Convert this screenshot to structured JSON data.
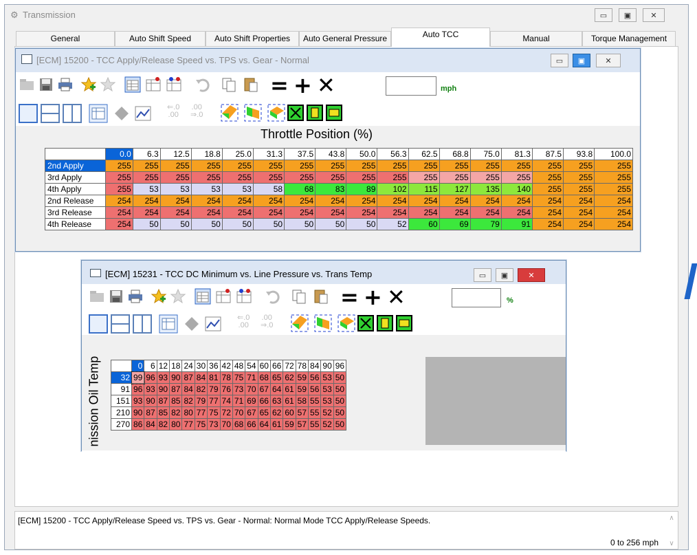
{
  "main_window": {
    "title": "Transmission",
    "tabs": [
      {
        "label": "General"
      },
      {
        "label": "Auto Shift Speed"
      },
      {
        "label": "Auto Shift Properties"
      },
      {
        "label": "Auto General Pressure"
      },
      {
        "label": "Auto TCC"
      },
      {
        "label": "Manual"
      },
      {
        "label": "Torque Management"
      }
    ],
    "active_tab": "Auto TCC",
    "status_description": "[ECM] 15200 - TCC Apply/Release Speed vs. TPS vs. Gear - Normal: Normal Mode TCC Apply/Release Speeds.",
    "status_range": "0 to 256 mph"
  },
  "window1": {
    "title": "[ECM] 15200 - TCC Apply/Release Speed vs. TPS vs. Gear - Normal",
    "unit": "mph",
    "axis_title": "Throttle Position (%)",
    "column_headers": [
      "0.0",
      "6.3",
      "12.5",
      "18.8",
      "25.0",
      "31.3",
      "37.5",
      "43.8",
      "50.0",
      "56.3",
      "62.5",
      "68.8",
      "75.0",
      "81.3",
      "87.5",
      "93.8",
      "100.0"
    ],
    "rows": [
      {
        "label": "2nd Apply",
        "values": [
          "255",
          "255",
          "255",
          "255",
          "255",
          "255",
          "255",
          "255",
          "255",
          "255",
          "255",
          "255",
          "255",
          "255",
          "255",
          "255",
          "255"
        ],
        "colors": [
          "o",
          "o",
          "o",
          "o",
          "o",
          "o",
          "o",
          "o",
          "o",
          "o",
          "o",
          "o",
          "o",
          "o",
          "o",
          "o",
          "o"
        ]
      },
      {
        "label": "3rd Apply",
        "values": [
          "255",
          "255",
          "255",
          "255",
          "255",
          "255",
          "255",
          "255",
          "255",
          "255",
          "255",
          "255",
          "255",
          "255",
          "255",
          "255",
          "255"
        ],
        "colors": [
          "r",
          "r",
          "r",
          "r",
          "r",
          "r",
          "r",
          "r",
          "r",
          "r",
          "p",
          "p",
          "p",
          "p",
          "o",
          "o",
          "o"
        ]
      },
      {
        "label": "4th Apply",
        "values": [
          "255",
          "53",
          "53",
          "53",
          "53",
          "58",
          "68",
          "83",
          "89",
          "102",
          "115",
          "127",
          "135",
          "140",
          "255",
          "255",
          "255"
        ],
        "colors": [
          "r",
          "l",
          "l",
          "l",
          "l",
          "l",
          "g",
          "g",
          "g",
          "g2",
          "g2",
          "g2",
          "g2",
          "g2",
          "o",
          "o",
          "o"
        ]
      },
      {
        "label": "2nd Release",
        "values": [
          "254",
          "254",
          "254",
          "254",
          "254",
          "254",
          "254",
          "254",
          "254",
          "254",
          "254",
          "254",
          "254",
          "254",
          "254",
          "254",
          "254"
        ],
        "colors": [
          "o",
          "o",
          "o",
          "o",
          "o",
          "o",
          "o",
          "o",
          "o",
          "o",
          "o",
          "o",
          "o",
          "o",
          "o",
          "o",
          "o"
        ]
      },
      {
        "label": "3rd Release",
        "values": [
          "254",
          "254",
          "254",
          "254",
          "254",
          "254",
          "254",
          "254",
          "254",
          "254",
          "254",
          "254",
          "254",
          "254",
          "254",
          "254",
          "254"
        ],
        "colors": [
          "r",
          "r",
          "r",
          "r",
          "r",
          "r",
          "r",
          "r",
          "r",
          "r",
          "r",
          "r",
          "r",
          "r",
          "o",
          "o",
          "o"
        ]
      },
      {
        "label": "4th Release",
        "values": [
          "254",
          "50",
          "50",
          "50",
          "50",
          "50",
          "50",
          "50",
          "50",
          "52",
          "60",
          "69",
          "79",
          "91",
          "254",
          "254",
          "254"
        ],
        "colors": [
          "r",
          "l",
          "l",
          "l",
          "l",
          "l",
          "l",
          "l",
          "l",
          "l",
          "g",
          "g",
          "g",
          "g",
          "o",
          "o",
          "o"
        ]
      }
    ]
  },
  "window2": {
    "title": "[ECM] 15231 - TCC DC Minimum vs. Line Pressure vs. Trans Temp",
    "unit": "%",
    "axis_title_vertical": "nission Oil Temp",
    "column_headers": [
      "0",
      "6",
      "12",
      "18",
      "24",
      "30",
      "36",
      "42",
      "48",
      "54",
      "60",
      "66",
      "72",
      "78",
      "84",
      "90",
      "96"
    ],
    "rows": [
      {
        "label": "32",
        "values": [
          "99",
          "96",
          "93",
          "90",
          "87",
          "84",
          "81",
          "78",
          "75",
          "71",
          "68",
          "65",
          "62",
          "59",
          "56",
          "53",
          "50"
        ]
      },
      {
        "label": "91",
        "values": [
          "96",
          "93",
          "90",
          "87",
          "84",
          "82",
          "79",
          "76",
          "73",
          "70",
          "67",
          "64",
          "61",
          "59",
          "56",
          "53",
          "50"
        ]
      },
      {
        "label": "151",
        "values": [
          "93",
          "90",
          "87",
          "85",
          "82",
          "79",
          "77",
          "74",
          "71",
          "69",
          "66",
          "63",
          "61",
          "58",
          "55",
          "53",
          "50"
        ]
      },
      {
        "label": "210",
        "values": [
          "90",
          "87",
          "85",
          "82",
          "80",
          "77",
          "75",
          "72",
          "70",
          "67",
          "65",
          "62",
          "60",
          "57",
          "55",
          "52",
          "50"
        ]
      },
      {
        "label": "270",
        "values": [
          "86",
          "84",
          "82",
          "80",
          "77",
          "75",
          "73",
          "70",
          "68",
          "66",
          "64",
          "61",
          "59",
          "57",
          "55",
          "52",
          "50"
        ]
      }
    ]
  },
  "icons": {
    "toolbar1": [
      "folder-icon",
      "save-icon",
      "print-icon",
      "favorite-add-icon",
      "favorite-icon",
      "table-view-icon",
      "compare-icon",
      "compare-alt-icon",
      "undo-icon",
      "copy-icon",
      "paste-icon",
      "equals-icon",
      "plus-icon",
      "multiply-icon"
    ],
    "toolbar2": [
      "layout-single-icon",
      "layout-split-h-icon",
      "layout-split-v-icon",
      "grid-icon",
      "3d-icon",
      "graph-icon",
      "decimal-dec-icon",
      "decimal-inc-icon",
      "color-3d-icon",
      "color-left-icon",
      "color-bottom-icon",
      "cross-icon",
      "square-icon",
      "square-alt-icon"
    ]
  },
  "colors": {
    "selected": "#0a64d8",
    "orange": "#f6a020",
    "red": "#ee7070",
    "pink": "#f4a6a6",
    "lavender": "#d9d9f4",
    "green": "#3ce83c",
    "lightgreen": "#8de83c",
    "grey": "#b4b4b4"
  }
}
